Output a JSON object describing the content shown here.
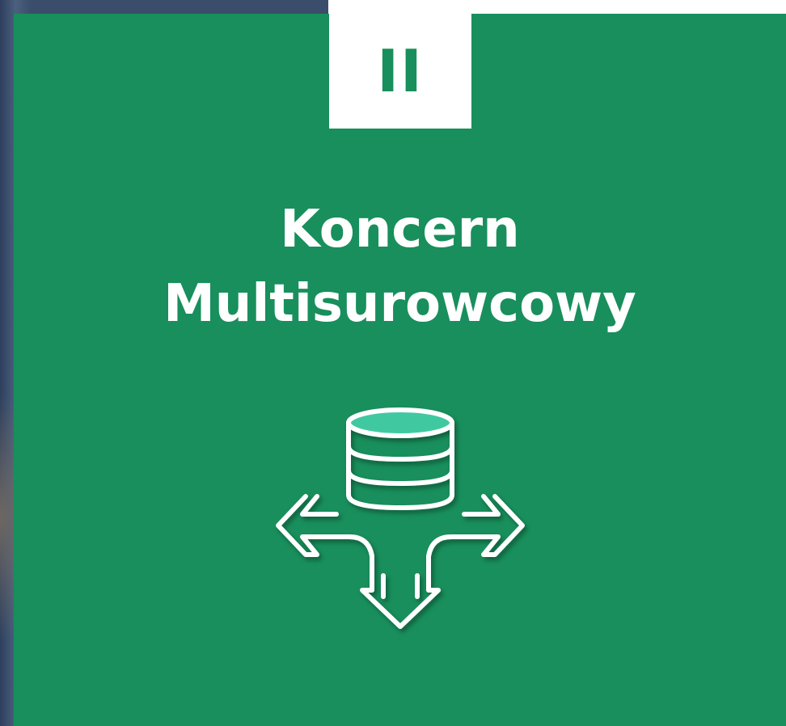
{
  "section": {
    "numeral": "II",
    "title_line1": "Koncern",
    "title_line2": "Multisurowcowy"
  },
  "icon": {
    "name": "database-distribution-arrows-icon"
  },
  "colors": {
    "card_green": "#188f5c",
    "accent_teal": "#40c9a0",
    "white": "#ffffff"
  }
}
